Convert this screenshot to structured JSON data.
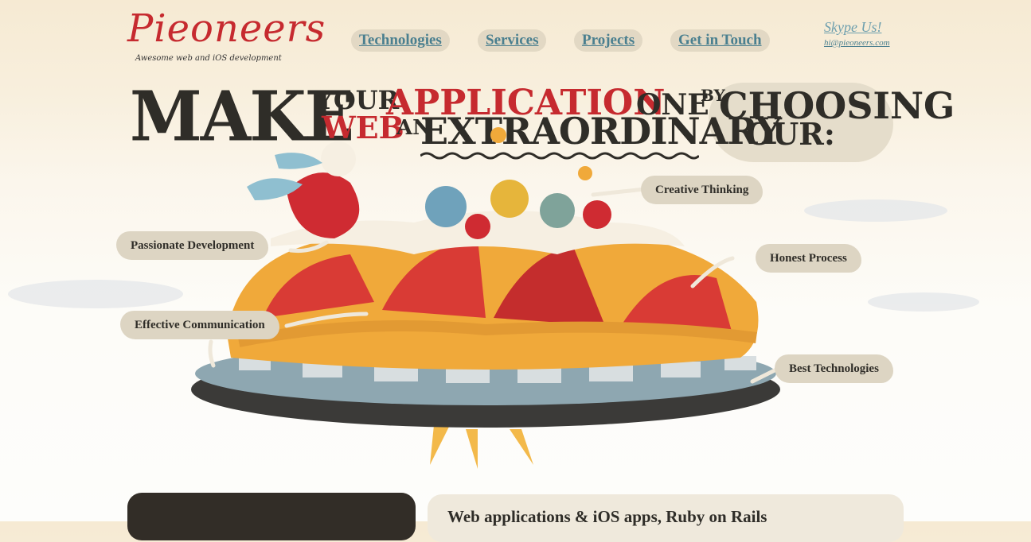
{
  "header": {
    "logo": "Pieoneers",
    "tagline": "Awesome web and iOS development",
    "nav": [
      "Technologies",
      "Services",
      "Projects",
      "Get in Touch"
    ],
    "skype_label": "Skype Us!",
    "email": "hi@pieoneers.com"
  },
  "headline": {
    "make": "MAKE",
    "your": "YOUR",
    "web": "WEB",
    "application": "APPLICATION",
    "an": "AN",
    "extraordinary": "EXTRAORDINARY",
    "one": "ONE",
    "by": "BY",
    "choosing": "CHOOSING",
    "our": "OUR:"
  },
  "features": {
    "creative": "Creative Thinking",
    "passionate": "Passionate Development",
    "honest": "Honest Process",
    "effective": "Effective Communication",
    "best": "Best Technologies"
  },
  "intro": {
    "heading": "Web applications & iOS apps, Ruby on Rails"
  },
  "colors": {
    "brand_red": "#c62a2f",
    "ink": "#2f2d28",
    "link_teal": "#4a7f8f",
    "bubble": "#ddd5c3"
  }
}
